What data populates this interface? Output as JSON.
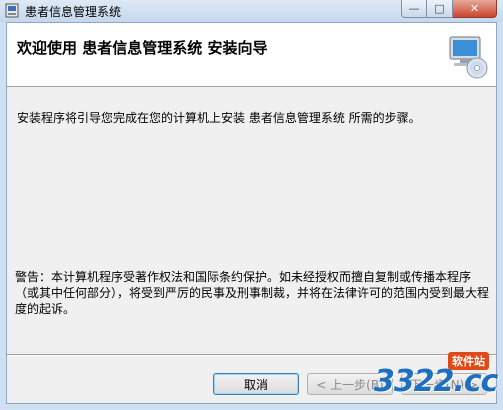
{
  "window": {
    "title": "患者信息管理系统",
    "controls": {
      "minimize": "—",
      "maximize": "□",
      "close": "✕"
    }
  },
  "header": {
    "title": "欢迎使用 患者信息管理系统 安装向导",
    "art_icon": "computer-cd-icon"
  },
  "body": {
    "intro": "安装程序将引导您完成在您的计算机上安装 患者信息管理系统 所需的步骤。",
    "warning": "警告：本计算机程序受著作权法和国际条约保护。如未经授权而擅自复制或传播本程序（或其中任何部分），将受到严厉的民事及刑事制裁，并将在法律许可的范围内受到最大程度的起诉。"
  },
  "buttons": {
    "cancel": "取消",
    "back": "< 上一步(B)",
    "next": "下一步(N) >"
  },
  "watermark": {
    "text": "3322.cc",
    "tag": "软件站"
  },
  "colors": {
    "titlebar": "#c5d7ee",
    "close_button": "#c9462c",
    "watermark_blue": "#1f6fc0",
    "watermark_tag": "#e04a1a"
  }
}
